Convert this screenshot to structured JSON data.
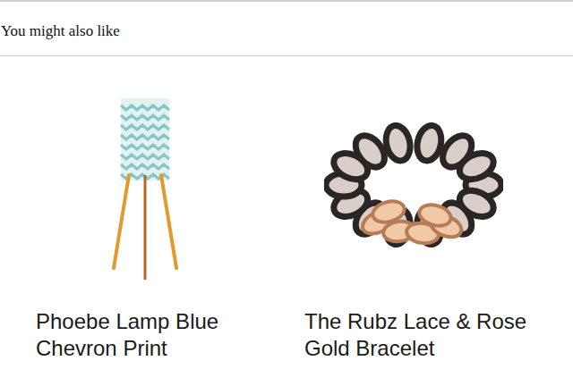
{
  "section": {
    "title": "You might also like"
  },
  "products": [
    {
      "name": "Phoebe Lamp Blue Chevron Print",
      "kind": "lamp"
    },
    {
      "name": "The Rubz Lace & Rose Gold Bracelet",
      "kind": "bracelet"
    }
  ]
}
